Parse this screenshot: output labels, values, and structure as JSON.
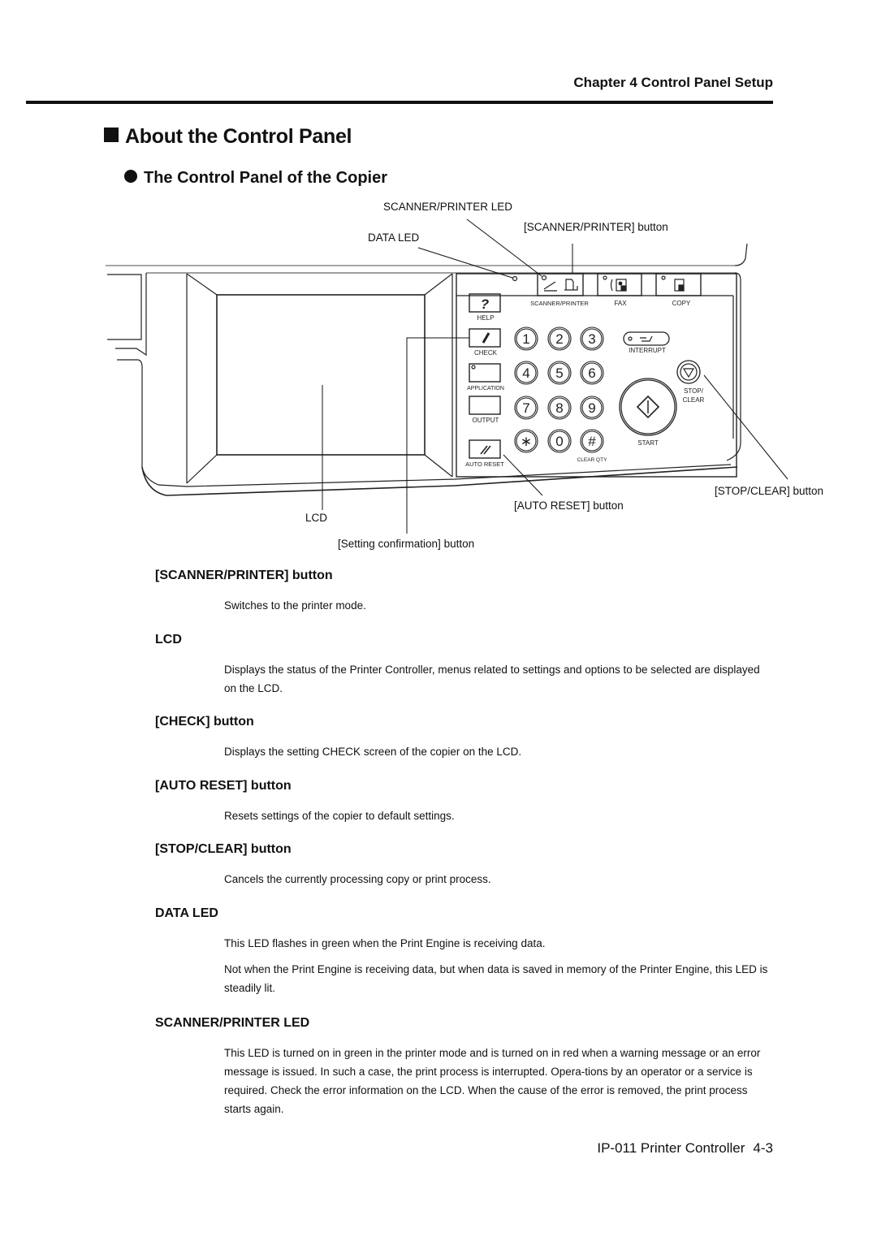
{
  "header": {
    "chapter": "Chapter 4  Control Panel Setup"
  },
  "title": "About the Control Panel",
  "subtitle": "The Control Panel of the Copier",
  "figure": {
    "callouts": {
      "scanner_printer_led": "SCANNER/PRINTER LED",
      "scanner_printer_button": "[SCANNER/PRINTER] button",
      "data_led": "DATA LED",
      "stop_clear_button": "[STOP/CLEAR] button",
      "auto_reset_button": "[AUTO RESET] button",
      "lcd": "LCD",
      "setting_confirmation_button": "[Setting confirmation] button"
    },
    "panel_labels": {
      "scanner_printer": "SCANNER/PRINTER",
      "fax": "FAX",
      "copy": "COPY",
      "help": "HELP",
      "help_glyph": "?",
      "check": "CHECK",
      "application": "APPLICATION",
      "output": "OUTPUT",
      "auto_reset": "AUTO RESET",
      "interrupt": "INTERRUPT",
      "stop": "STOP/",
      "clear": "CLEAR",
      "start": "START",
      "clear_qty": "CLEAR QTY"
    },
    "keypad": [
      "1",
      "2",
      "3",
      "4",
      "5",
      "6",
      "7",
      "8",
      "9",
      "*",
      "0",
      "#"
    ]
  },
  "sections": [
    {
      "title": "[SCANNER/PRINTER] button",
      "paragraphs": [
        "Switches to the printer mode."
      ]
    },
    {
      "title": "LCD",
      "paragraphs": [
        "Displays the status of the Printer Controller, menus related to settings and options to be selected are displayed on the LCD."
      ]
    },
    {
      "title": "[CHECK] button",
      "paragraphs": [
        "Displays the setting CHECK screen of the copier on the LCD."
      ]
    },
    {
      "title": "[AUTO RESET] button",
      "paragraphs": [
        "Resets settings of the copier to default settings."
      ]
    },
    {
      "title": "[STOP/CLEAR] button",
      "paragraphs": [
        "Cancels the currently processing copy or print process."
      ]
    },
    {
      "title": "DATA LED",
      "paragraphs": [
        "This LED flashes in green when the Print Engine is receiving data.",
        "Not when the Print Engine is receiving data, but when data is saved in memory of the Printer Engine, this LED is steadily lit."
      ]
    },
    {
      "title": "SCANNER/PRINTER LED",
      "paragraphs": [
        "This LED is turned on in green in the printer mode and is turned on in red when a warning message or an error message is issued. In such a case, the print process is interrupted. Opera-tions by an operator or a service is required. Check the error information on the LCD. When the cause of the error is removed, the print process starts again."
      ]
    }
  ],
  "footer": {
    "product": "IP-011 Printer Controller",
    "page": "4-3"
  }
}
